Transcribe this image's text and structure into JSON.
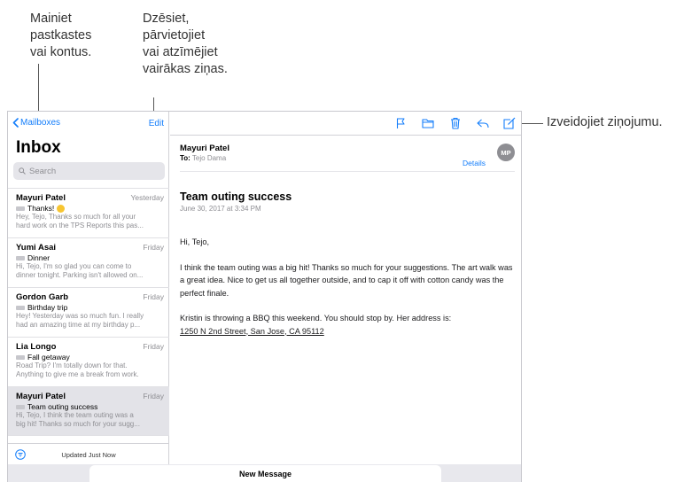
{
  "callouts": {
    "mailboxes": "Mainiet\npastkastes\nvai kontus.",
    "edit": "Dzēsiet,\npārvietojiet\nvai atzīmējiet\nvairākas ziņas.",
    "compose": "Izveidojiet ziņojumu."
  },
  "sidebar": {
    "back_label": "Mailboxes",
    "edit_label": "Edit",
    "title": "Inbox",
    "search_placeholder": "Search",
    "footer_status": "Updated Just Now"
  },
  "messages": [
    {
      "sender": "Mayuri Patel",
      "date": "Yesterday",
      "subject": "Thanks!",
      "preview1": "Hey, Tejo, Thanks so much for all your",
      "preview2": "hard work on the TPS Reports this pas..."
    },
    {
      "sender": "Yumi Asai",
      "date": "Friday",
      "subject": "Dinner",
      "preview1": "Hi, Tejo, I'm so glad you can come to",
      "preview2": "dinner tonight. Parking isn't allowed on..."
    },
    {
      "sender": "Gordon Garb",
      "date": "Friday",
      "subject": "Birthday trip",
      "preview1": "Hey! Yesterday was so much fun. I really",
      "preview2": "had an amazing time at my birthday p..."
    },
    {
      "sender": "Lia Longo",
      "date": "Friday",
      "subject": "Fall getaway",
      "preview1": "Road Trip? I'm totally down for that.",
      "preview2": "Anything to give me a break from work."
    },
    {
      "sender": "Mayuri Patel",
      "date": "Friday",
      "subject": "Team outing success",
      "preview1": "Hi, Tejo, I think the team outing was a",
      "preview2": "big hit! Thanks so much for your sugg..."
    }
  ],
  "detail": {
    "sender": "Mayuri Patel",
    "to_label": "To:",
    "to_value": "Tejo Dama",
    "details_label": "Details",
    "avatar_initials": "MP",
    "subject": "Team outing success",
    "date": "June 30, 2017 at 3:34 PM",
    "greeting": "Hi, Tejo,",
    "paragraph1": "I think the team outing was a big hit! Thanks so much for your suggestions. The art walk was a great idea. Nice to get us all together outside, and to cap it off with cotton candy was the perfect finale.",
    "paragraph2": "Kristin is throwing a BBQ this weekend. You should stop by. Her address is:",
    "address": "1250 N 2nd Street, San Jose, CA 95112"
  },
  "bottom_bar": {
    "new_message_label": "New Message"
  },
  "colors": {
    "accent": "#147efb",
    "secondary_text": "#8e8e93",
    "selected_row": "#e3e3e8"
  },
  "icons": [
    "chevron-left-icon",
    "search-icon",
    "flag-icon",
    "folder-icon",
    "trash-icon",
    "reply-icon",
    "compose-icon",
    "filter-icon"
  ]
}
